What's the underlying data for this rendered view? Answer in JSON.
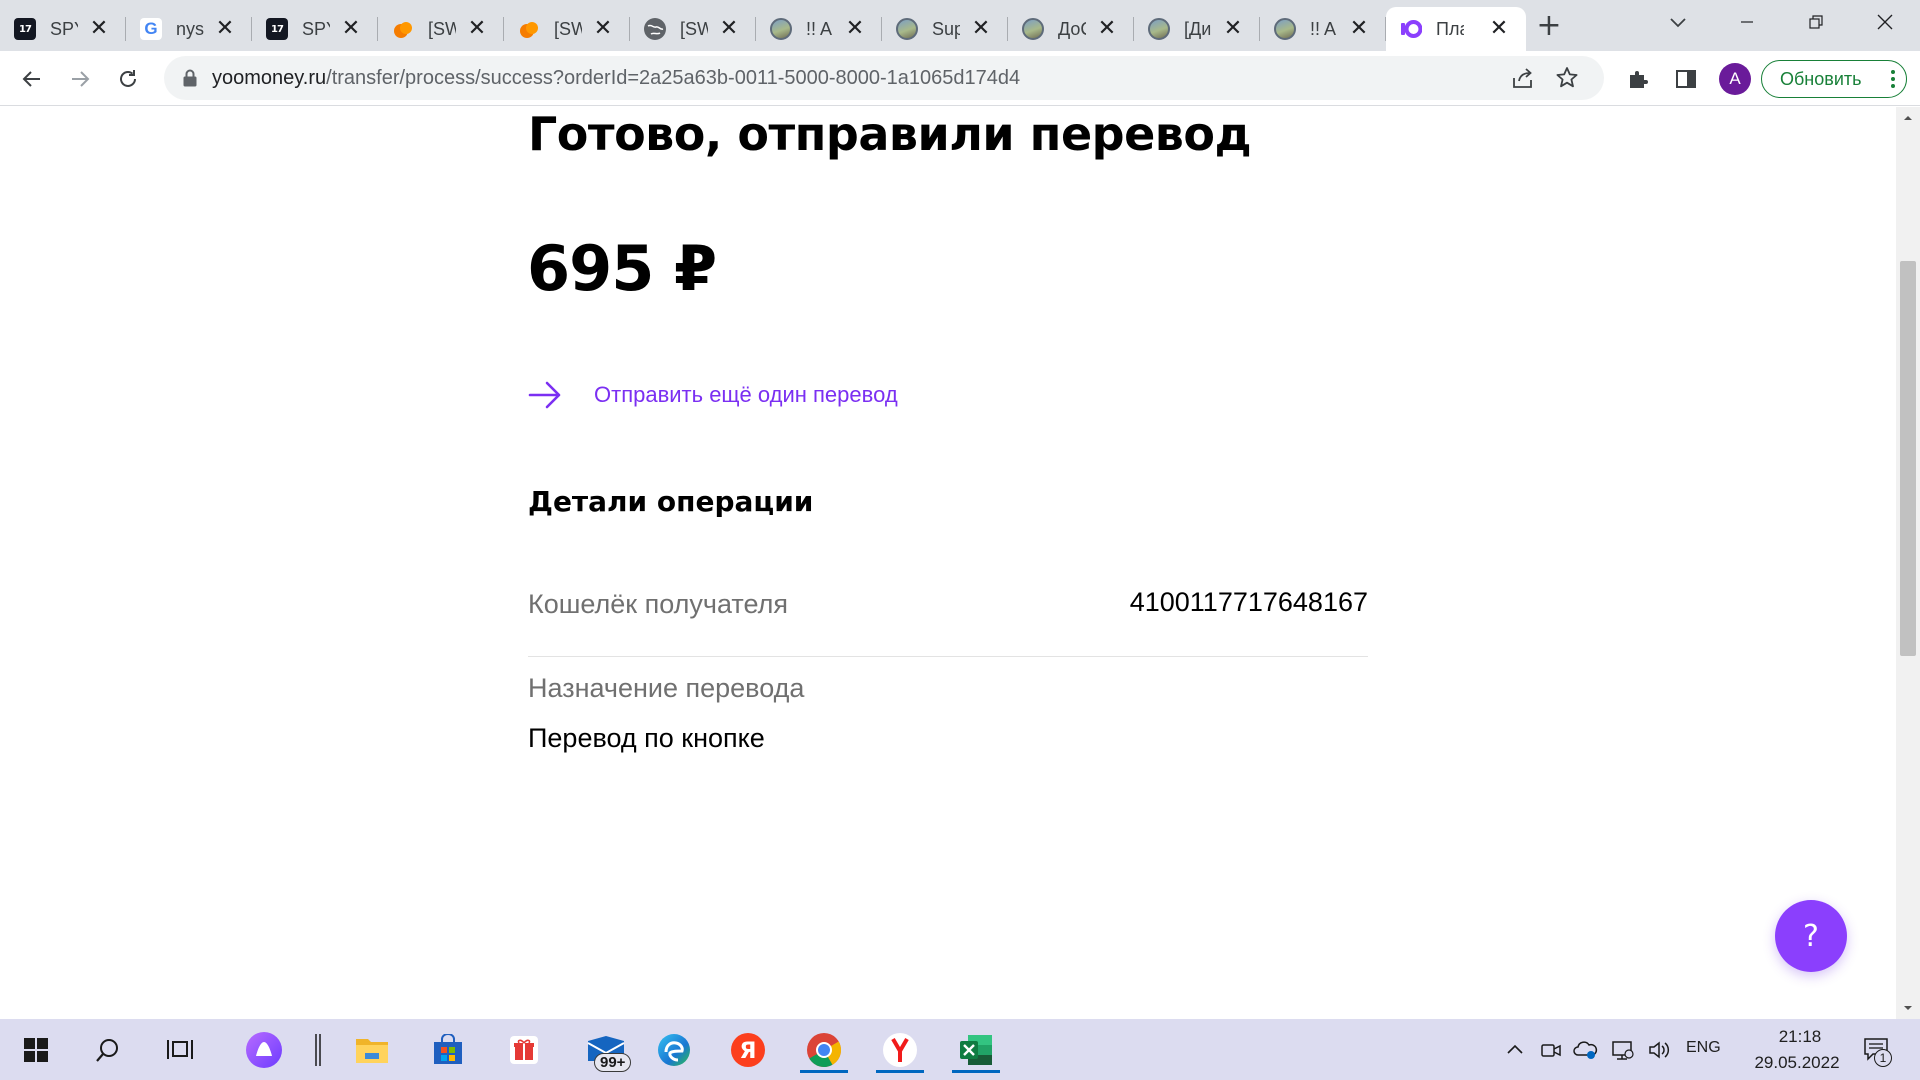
{
  "browser": {
    "tabs": [
      {
        "title": "SPY",
        "favicon": "tradingview-icon"
      },
      {
        "title": "nyse",
        "favicon": "google-icon"
      },
      {
        "title": "SPY",
        "favicon": "tradingview-icon"
      },
      {
        "title": "[SW",
        "favicon": "orange-drop-icon"
      },
      {
        "title": "[SW",
        "favicon": "orange-drop-icon"
      },
      {
        "title": "[SW",
        "favicon": "globe-icon"
      },
      {
        "title": "!! A",
        "favicon": "picture-icon"
      },
      {
        "title": "Sup",
        "favicon": "picture-icon"
      },
      {
        "title": "ДоС",
        "favicon": "picture-icon"
      },
      {
        "title": "[Ди",
        "favicon": "picture-icon"
      },
      {
        "title": "!! A",
        "favicon": "picture-icon"
      },
      {
        "title": "Пла",
        "favicon": "yoomoney-icon",
        "active": true
      }
    ],
    "url": {
      "domain": "yoomoney.ru",
      "path": "/transfer/process/success?orderId=2a25a63b-0011-5000-8000-1a1065d174d4"
    },
    "profile_initial": "A",
    "update_label": "Обновить"
  },
  "page": {
    "title": "Готово, отправили перевод",
    "amount": "695 ₽",
    "send_again_label": "Отправить ещё один перевод",
    "details_title": "Детали операции",
    "wallet_label": "Кошелёк получателя",
    "wallet_value": "4100117717648167",
    "purpose_label": "Назначение перевода",
    "purpose_value": "Перевод по кнопке",
    "help_label": "?",
    "accent_color": "#8b3ffd"
  },
  "taskbar": {
    "mail_badge": "99+",
    "language": "ENG",
    "time": "21:18",
    "date": "29.05.2022",
    "notification_count": "1"
  }
}
